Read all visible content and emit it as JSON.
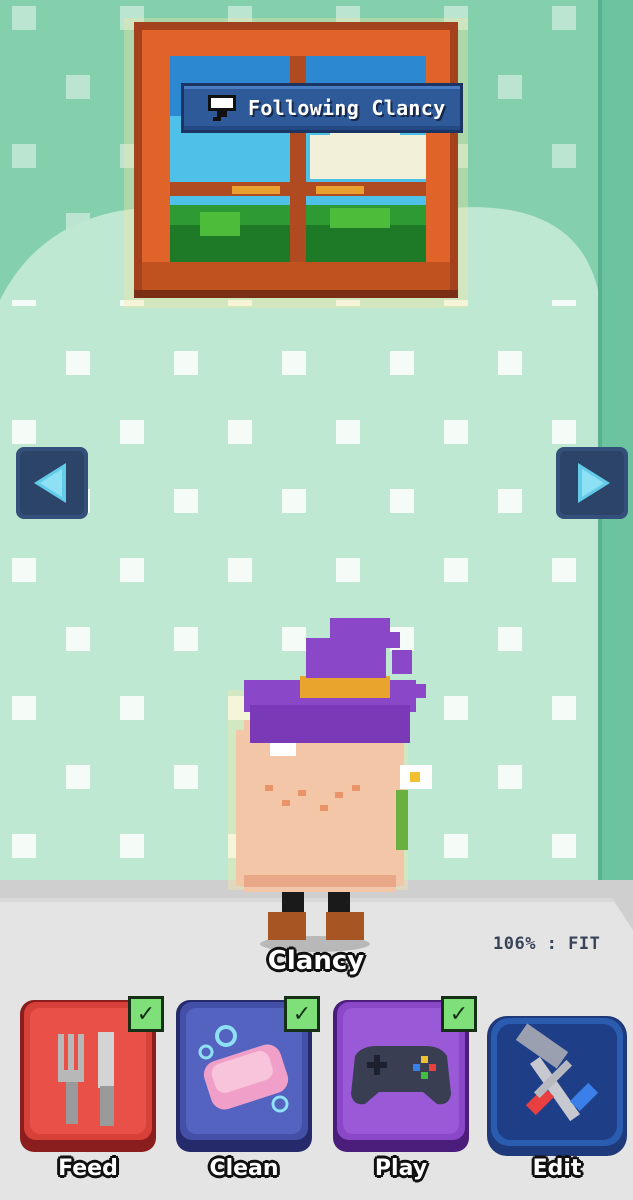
{
  "banner": {
    "text": "Following Clancy",
    "icon": "camera-icon"
  },
  "navigation": {
    "left_icon": "arrow-left-icon",
    "right_icon": "arrow-right-icon"
  },
  "zoom": {
    "readout": "106% : FIT"
  },
  "pet": {
    "name": "Clancy"
  },
  "actions": [
    {
      "label": "Feed",
      "icon": "fork-knife-icon",
      "completed": true,
      "color": "#d8403a"
    },
    {
      "label": "Clean",
      "icon": "soap-icon",
      "completed": true,
      "color": "#4450a8"
    },
    {
      "label": "Play",
      "icon": "gamepad-icon",
      "completed": true,
      "color": "#8a48c8"
    },
    {
      "label": "Edit",
      "icon": "tools-icon",
      "completed": false,
      "color": "#2a5cb0"
    }
  ],
  "checkmark": "✓",
  "colors": {
    "wall": "#bfe8d2",
    "wall_dark": "#84d0ac",
    "floor": "#e4e4e4",
    "accent": "#2f5a9a"
  }
}
